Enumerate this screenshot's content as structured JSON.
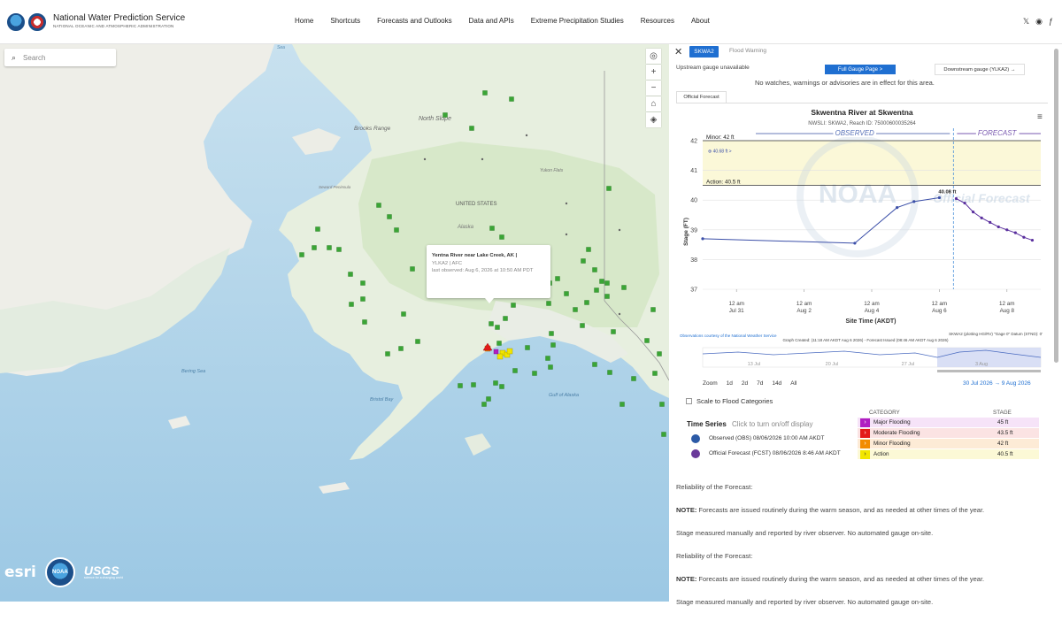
{
  "header": {
    "title": "National Water Prediction Service",
    "subtitle": "NATIONAL OCEANIC AND ATMOSPHERIC ADMINISTRATION",
    "nav": [
      "Home",
      "Shortcuts",
      "Forecasts and Outlooks",
      "Data and APIs",
      "Extreme Precipitation Studies",
      "Resources",
      "About"
    ],
    "social": [
      "X",
      "GitHub",
      "Facebook"
    ]
  },
  "map": {
    "search_placeholder": "Search",
    "labels": {
      "north_slope": "North Slope",
      "brooks_range": "Brooks Range",
      "united_states": "UNITED STATES",
      "alaska": "Alaska",
      "bering_sea": "Bering Sea",
      "gulf_of_alaska": "Gulf of Alaska",
      "bristol_bay": "Bristol Bay",
      "yukon_flats": "Yukon Flats",
      "sea": "Sea",
      "seward_peninsula": "Seward Peninsula"
    },
    "popup": {
      "name": "Yentna River near Lake Creek, AK |",
      "id": "YLKA2 | AFC",
      "observed": "last observed: Aug 6, 2026 at 10:50 AM PDT"
    },
    "credits": {
      "esri": "esri",
      "noaa": "NOAA",
      "usgs": "USGS",
      "usgs_tag": "science for a changing world"
    },
    "marker_colors": {
      "normal": "#3aa535",
      "action": "#f2e600",
      "minor": "#f28c00",
      "major": "#b01fc2",
      "moderate": "#e31a1a"
    }
  },
  "panel": {
    "tabs": [
      "SKWA2",
      "Flood Warning"
    ],
    "upstream": "Upstream gauge unavailable",
    "full_gauge_button": "Full Gauge Page >",
    "downstream_button": "Downstream gauge (YLKA2) →",
    "no_warnings": "No watches, warnings or advisories are in effect for this area.",
    "official_tab": "Official Forecast",
    "zoom_label": "Zoom",
    "zoom_options": [
      "1d",
      "2d",
      "7d",
      "14d",
      "All"
    ],
    "date_from": "30 Jul 2026",
    "date_to": "9 Aug 2026",
    "scale_label": "Scale to Flood Categories",
    "time_series": {
      "title": "Time Series",
      "hint": "Click to turn on/off display",
      "observed": "Observed (OBS) 08/06/2026 10:00 AM AKDT",
      "forecast": "Official Forecast (FCST) 08/06/2026 8:46 AM AKDT"
    },
    "categories": {
      "head_category": "CATEGORY",
      "head_stage": "STAGE",
      "rows": [
        {
          "name": "Major Flooding",
          "stage": "45 ft",
          "color": "#b01fc2",
          "bg": "#f6e3f8"
        },
        {
          "name": "Moderate Flooding",
          "stage": "43.5 ft",
          "color": "#e31a1a",
          "bg": "#fbe3e3"
        },
        {
          "name": "Minor Flooding",
          "stage": "42 ft",
          "color": "#f28c00",
          "bg": "#fdebd6"
        },
        {
          "name": "Action",
          "stage": "40.5 ft",
          "color": "#f2e600",
          "bg": "#fcf9d6"
        }
      ]
    },
    "notes": [
      {
        "label": "",
        "text": "Reliability of the Forecast:"
      },
      {
        "label": "NOTE:",
        "text": " Forecasts are issued routinely during the warm season, and as needed at other times of the year."
      },
      {
        "label": "",
        "text": "Stage measured manually and reported by river observer. No automated gauge on-site."
      },
      {
        "label": "",
        "text": "Reliability of the Forecast:"
      },
      {
        "label": "NOTE:",
        "text": " Forecasts are issued routinely during the warm season, and as needed at other times of the year."
      },
      {
        "label": "",
        "text": "Stage measured manually and reported by river observer. No automated gauge on-site."
      }
    ]
  },
  "chart_data": {
    "type": "line",
    "title": "Skwentna River at Skwentna",
    "subtitle": "NWSLI: SKWA2, Reach ID: 75000600035264",
    "xlabel": "Site Time (AKDT)",
    "ylabel": "Stage (FT)",
    "ylim": [
      37,
      42
    ],
    "yticks": [
      "37",
      "38",
      "39",
      "40",
      "41",
      "42"
    ],
    "xticks": [
      "12 am\nJul 31",
      "12 am\nAug 2",
      "12 am\nAug 4",
      "12 am\nAug 6",
      "12 am\nAug 8"
    ],
    "observed_label": "OBSERVED",
    "forecast_label": "FORECAST",
    "minor_label": "Minor: 42 ft",
    "action_label": "Action: 40.5 ft",
    "flow_label": "40.68 ft",
    "peak_label": "40.08 ft",
    "watermark": "NOAA",
    "watermark2": "Official Forecast",
    "credit": "Observations courtesy of the National Weather Service",
    "datum": "SKWA2 (plotting HG/RV) \"Gage 0\" Datum (STND): 0'",
    "created": "Graph Created: (11:18 AM AKDT Aug 6 2026) - Forecast Issued (08:46 AM AKDT Aug 6 2026)",
    "navigator_labels": [
      "13 Jul",
      "20 Jul",
      "27 Jul",
      "3 Aug"
    ],
    "series": [
      {
        "name": "Observed",
        "color": "#3b4fa8",
        "x": [
          "2026-07-30 00:00",
          "2026-08-03 12:00",
          "2026-08-04 18:00",
          "2026-08-05 06:00",
          "2026-08-06 00:00"
        ],
        "values": [
          38.7,
          38.55,
          39.75,
          39.95,
          40.08
        ]
      },
      {
        "name": "Forecast",
        "color": "#5a2f9e",
        "x": [
          "2026-08-06 12:00",
          "2026-08-06 18:00",
          "2026-08-07 00:00",
          "2026-08-07 06:00",
          "2026-08-07 12:00",
          "2026-08-07 18:00",
          "2026-08-08 00:00",
          "2026-08-08 06:00",
          "2026-08-08 12:00",
          "2026-08-08 18:00"
        ],
        "values": [
          40.05,
          39.9,
          39.6,
          39.4,
          39.25,
          39.1,
          39.0,
          38.9,
          38.75,
          38.65
        ]
      }
    ]
  }
}
